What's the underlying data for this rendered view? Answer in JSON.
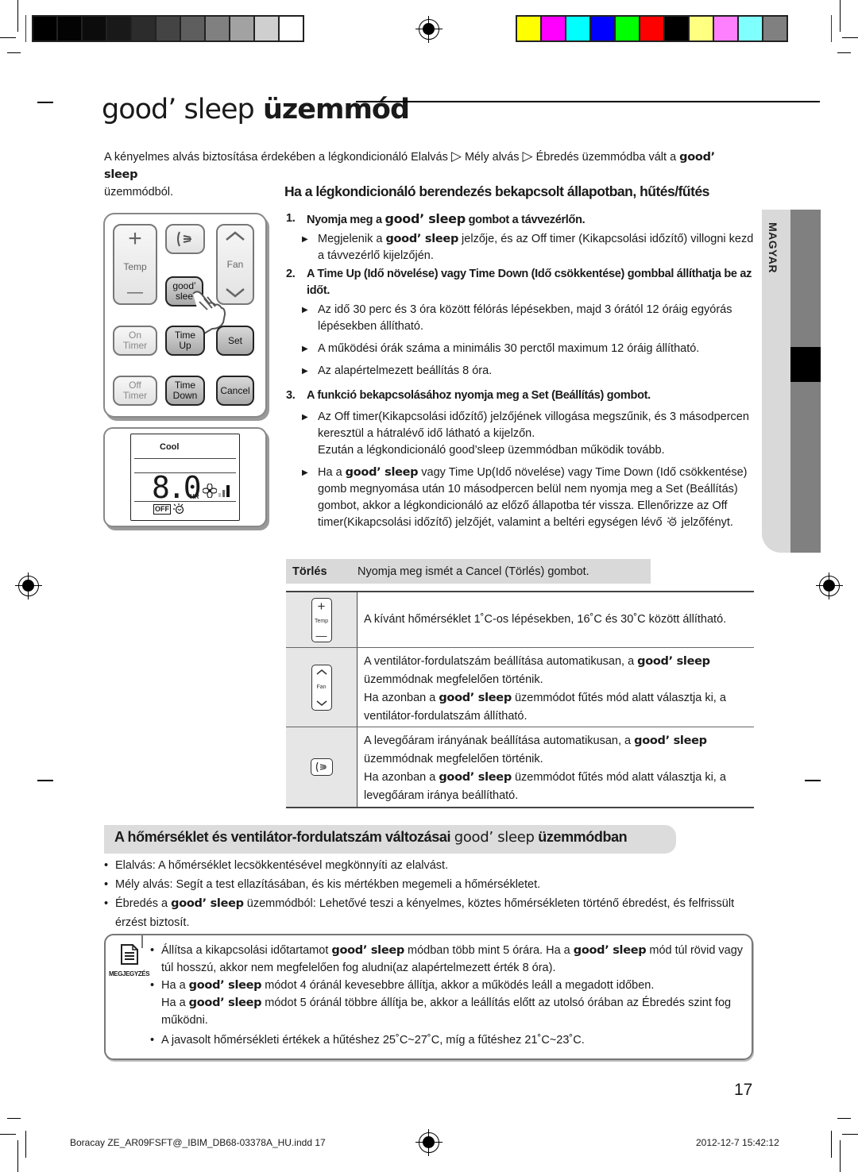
{
  "print_marks": {
    "grayscale": [
      "#000000",
      "#030303",
      "#0c0c0c",
      "#191919",
      "#2c2c2c",
      "#444444",
      "#5e5e5e",
      "#808080",
      "#a2a2a2",
      "#cfcfcf",
      "#ffffff"
    ],
    "colors": [
      "#ffff00",
      "#ff00ff",
      "#00ffff",
      "#0000ff",
      "#00ff00",
      "#ff0000",
      "#000000",
      "#ffff80",
      "#ff80ff",
      "#80ffff",
      "#808080"
    ]
  },
  "title": {
    "brand": "good’ sleep",
    "rest": " üzemmód"
  },
  "intro": {
    "pre": "A kényelmes alvás biztosítása érdekében a légkondicionáló Elalvás ",
    "arrow": "▷",
    "mid1": " Mély alvás ",
    "mid2": " Ébredés üzemmódba vált a ",
    "brand": "good’ sleep",
    "post": "üzemmódból."
  },
  "subheading": "Ha a légkondicionáló berendezés bekapcsolt állapotban, hűtés/fűtés",
  "remote": {
    "temp_plus": "+",
    "temp_label": "Temp",
    "temp_minus": "—",
    "fan_label": "Fan",
    "goodsleep_l1": "good’",
    "goodsleep_l2": "slee",
    "on_timer": [
      "On",
      "Timer"
    ],
    "time_up": [
      "Time",
      "Up"
    ],
    "set": "Set",
    "off_timer": [
      "Off",
      "Timer"
    ],
    "time_down": [
      "Time",
      "Down"
    ],
    "cancel": "Cancel"
  },
  "lcd": {
    "mode": "Cool",
    "value": "8.0",
    "unit": "HR",
    "off": "OFF"
  },
  "steps": [
    {
      "num": "1.",
      "head_pre": "Nyomja meg a ",
      "head_brand": "good’ sleep",
      "head_post": " gombot a távvezérlőn.",
      "bullets": [
        {
          "pre": "Megjelenik a ",
          "brand": "good’ sleep",
          "post": " jelzője, és az Off timer (Kikapcsolási időzítő) villogni kezd a távvezérlő kijelzőjén."
        }
      ]
    },
    {
      "num": "2.",
      "head": "A Time Up (Idő növelése) vagy Time Down (Idő csökkentése) gombbal állíthatja be az időt.",
      "bullets": [
        {
          "text": "Az idő 30 perc és 3 óra között félórás lépésekben, majd 3 órától 12 óráig egyórás lépésekben állítható."
        },
        {
          "text": "A működési órák száma a minimális 30 perctől maximum 12 óráig állítható."
        },
        {
          "text": "Az alapértelmezett beállítás 8 óra."
        }
      ]
    },
    {
      "num": "3.",
      "head": "A funkció bekapcsolásához nyomja meg a Set (Beállítás) gombot.",
      "bullets": [
        {
          "text": "Az Off timer(Kikapcsolási időzítő) jelzőjének villogása megszűnik, és 3 másodpercen keresztül a hátralévő idő látható a kijelzőn.",
          "extra": "Ezután a légkondicionáló good’sleep üzemmódban működik tovább."
        },
        {
          "pre": "Ha a ",
          "brand": "good’ sleep",
          "post": " vagy Time Up(Idő növelése) vagy Time Down (Idő csökkentése) gomb megnyomása után 10 másodpercen belül nem nyomja meg a Set (Beállítás) gombot, akkor a légkondicionáló az előző állapotba tér vissza.  Ellenőrizze az Off timer(Kikapcsolási időzítő) jelzőjét, valamint a beltéri egységen lévő ",
          "post2": " jelzőfényt."
        }
      ]
    }
  ],
  "cancel_row": {
    "key": "Törlés",
    "value": "Nyomja meg ismét a Cancel (Törlés) gombot."
  },
  "table": [
    {
      "icon": "temp",
      "icon_label": "Temp",
      "text": "A kívánt hőmérséklet 1˚C-os lépésekben, 16˚C és 30˚C között állítható."
    },
    {
      "icon": "fan",
      "icon_label": "Fan",
      "l1_pre": "A ventilátor-fordulatszám beállítása automatikusan, a ",
      "l1_post": " üzemmódnak megfelelően történik.",
      "l2_pre": "Ha azonban a ",
      "l2_post": " üzemmódot fűtés mód alatt választja ki, a ventilátor-fordulatszám állítható."
    },
    {
      "icon": "airflow",
      "icon_label": "",
      "l1_pre": "A levegőáram irányának beállítása automatikusan, a ",
      "l1_post": " üzemmódnak megfelelően történik.",
      "l2_pre": "Ha azonban a ",
      "l2_post": " üzemmódot fűtés mód alatt választja ki, a levegőáram iránya beállítható."
    }
  ],
  "brand": "good’ sleep",
  "side_tab": "MAGYAR",
  "section2": {
    "heading_pre": "A hőmérséklet és ventilátor-fordulatszám változásai ",
    "heading_post": " üzemmódban",
    "bullets": [
      {
        "text": "Elalvás:  A hőmérséklet lecsökkentésével megkönnyíti az elalvást."
      },
      {
        "text": "Mély alvás: Segít a test ellazításában, és kis mértékben megemeli a hőmérsékletet."
      },
      {
        "pre": "Ébredés a ",
        "post": " üzemmódból: Lehetővé teszi a kényelmes, köztes hőmérsékleten történő ébredést, és felfrissült érzést biztosít."
      }
    ]
  },
  "note": {
    "label": "MEGJEGYZÉS",
    "b1_a": "Állítsa a kikapcsolási időtartamot ",
    "b1_b": " módban több mint 5 órára. Ha a ",
    "b1_c": " mód túl rövid vagy túl hosszú, akkor nem megfelelően fog aludni(az alapértelmezett érték 8 óra).",
    "b2_a": "Ha a ",
    "b2_b": " módot 4 óránál kevesebbre állítja, akkor a működés leáll a megadott időben.",
    "b2_c": "Ha a ",
    "b2_d": " módot 5 óránál többre állítja be, akkor a leállítás előtt az utolsó órában az Ébredés szint fog működni.",
    "b3": "A javasolt hőmérsékleti értékek a hűtéshez 25˚C~27˚C, míg a fűtéshez 21˚C~23˚C."
  },
  "page_number": "17",
  "footer": {
    "file": "Boracay ZE_AR09FSFT@_IBIM_DB68-03378A_HU.indd   17",
    "timestamp": "2012-12-7   15:42:12"
  }
}
